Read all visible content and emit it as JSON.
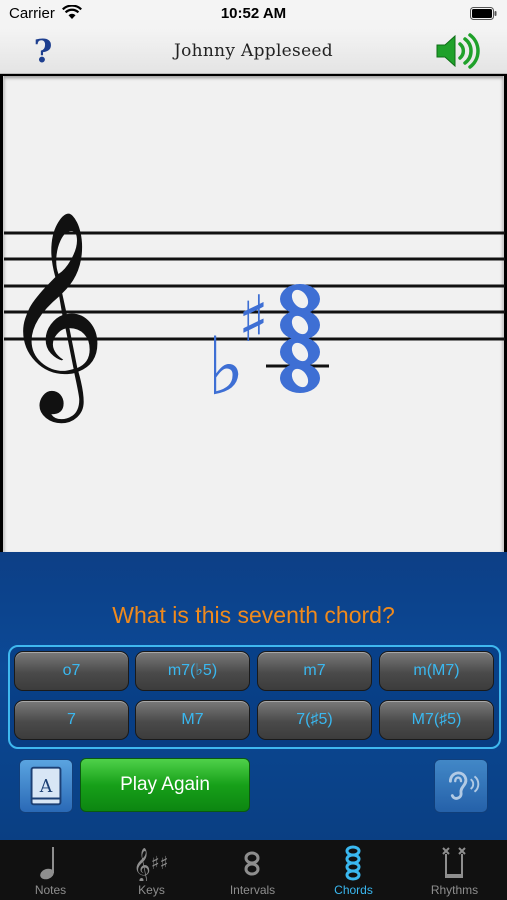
{
  "status_bar": {
    "carrier": "Carrier",
    "time": "10:52 AM"
  },
  "nav": {
    "title": "Johnny Appleseed",
    "help_label": "?"
  },
  "question": "What is this seventh chord?",
  "answers": [
    {
      "label": "o7"
    },
    {
      "label": "m7(♭5)"
    },
    {
      "label": "m7"
    },
    {
      "label": "m(M7)"
    },
    {
      "label": "7"
    },
    {
      "label": "M7"
    },
    {
      "label": "7(♯5)"
    },
    {
      "label": "M7(♯5)"
    }
  ],
  "controls": {
    "play_again": "Play Again",
    "reference_letter": "A"
  },
  "tabs": [
    {
      "label": "Notes",
      "icon": "quarter-note-icon",
      "active": false
    },
    {
      "label": "Keys",
      "icon": "key-signature-icon",
      "active": false
    },
    {
      "label": "Intervals",
      "icon": "interval-icon",
      "active": false
    },
    {
      "label": "Chords",
      "icon": "chord-icon",
      "active": true
    },
    {
      "label": "Rhythms",
      "icon": "rhythm-icon",
      "active": false
    }
  ],
  "colors": {
    "accent": "#3ab8f0",
    "question": "#f08a1c",
    "notes": "#3e6fd4",
    "panel": "#0b4996",
    "play": "#17a019"
  }
}
